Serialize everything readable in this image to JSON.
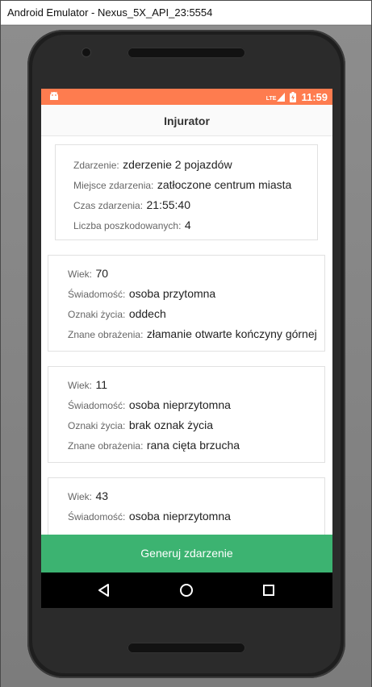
{
  "window": {
    "title": "Android Emulator - Nexus_5X_API_23:5554"
  },
  "statusbar": {
    "network_label": "LTE",
    "time": "11:59",
    "icons": [
      "android-icon",
      "lte-signal-icon",
      "battery-charging-icon"
    ]
  },
  "app": {
    "title": "Injurator"
  },
  "incident": {
    "event_label": "Zdarzenie:",
    "event_value": "zderzenie 2 pojazdów",
    "place_label": "Miejsce zdarzenia:",
    "place_value": "zatłoczone centrum miasta",
    "time_label": "Czas zdarzenia:",
    "time_value": "21:55:40",
    "victims_label": "Liczba poszkodowanych:",
    "victims_value": "4"
  },
  "labels": {
    "age": "Wiek:",
    "consciousness": "Świadomość:",
    "vital_signs": "Oznaki życia:",
    "injuries": "Znane obrażenia:"
  },
  "patients": [
    {
      "age": "70",
      "consciousness": "osoba przytomna",
      "vital_signs": "oddech",
      "injuries": "złamanie otwarte kończyny górnej"
    },
    {
      "age": "11",
      "consciousness": "osoba nieprzytomna",
      "vital_signs": "brak oznak życia",
      "injuries": "rana cięta brzucha"
    },
    {
      "age": "43",
      "consciousness": "osoba nieprzytomna",
      "vital_signs": "",
      "injuries": ""
    }
  ],
  "actions": {
    "generate_label": "Generuj zdarzenie"
  },
  "navbar": {
    "icons": [
      "back-icon",
      "home-icon",
      "recents-icon"
    ]
  }
}
